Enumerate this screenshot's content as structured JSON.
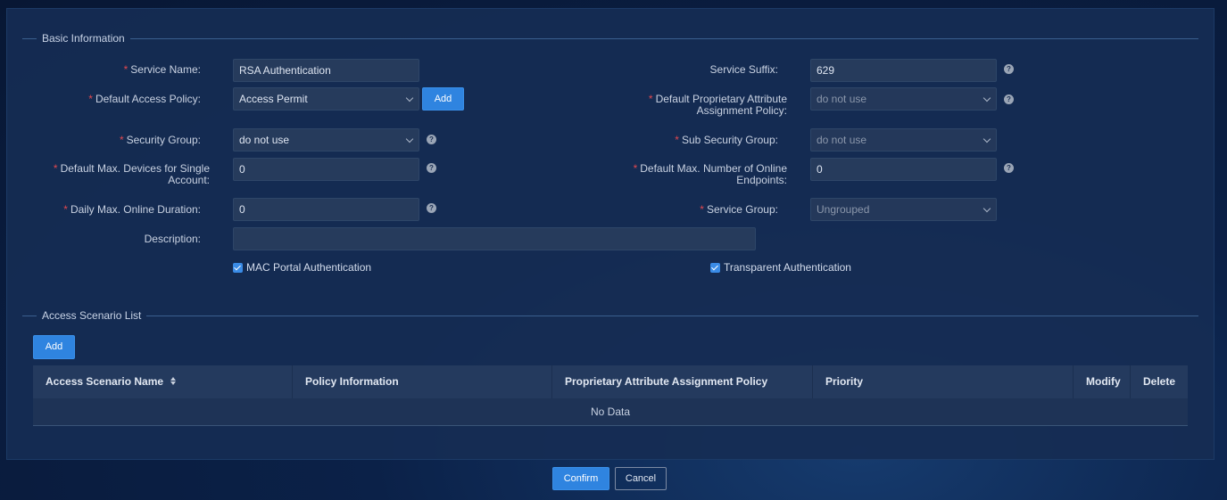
{
  "basic_section": {
    "title": "Basic Information"
  },
  "fields": {
    "service_name": {
      "label": "Service Name:",
      "value": "RSA Authentication",
      "required": true
    },
    "service_suffix": {
      "label": "Service Suffix:",
      "value": "629",
      "required": false
    },
    "default_access_policy": {
      "label": "Default Access Policy:",
      "value": "Access Permit",
      "required": true,
      "add_label": "Add"
    },
    "default_proprietary_policy": {
      "label_line1": "Default Proprietary Attribute",
      "label_line2": "Assignment Policy:",
      "value": "do not use",
      "required": true
    },
    "security_group": {
      "label": "Security Group:",
      "value": "do not use",
      "required": true
    },
    "sub_security_group": {
      "label": "Sub Security Group:",
      "value": "do not use",
      "required": true
    },
    "max_devices": {
      "label_line1": "Default Max. Devices for Single",
      "label_line2": "Account:",
      "value": "0",
      "required": true
    },
    "max_online_endpoints": {
      "label_line1": "Default Max. Number of Online",
      "label_line2": "Endpoints:",
      "value": "0",
      "required": true
    },
    "daily_max_duration": {
      "label": "Daily Max. Online Duration:",
      "value": "0",
      "required": true
    },
    "service_group": {
      "label": "Service Group:",
      "value": "Ungrouped",
      "required": true
    },
    "description": {
      "label": "Description:",
      "value": ""
    }
  },
  "checkboxes": {
    "mac_portal": {
      "label": "MAC Portal Authentication",
      "checked": true
    },
    "transparent": {
      "label": "Transparent Authentication",
      "checked": true
    }
  },
  "scenario_section": {
    "title": "Access Scenario List",
    "add_label": "Add",
    "columns": [
      "Access Scenario Name",
      "Policy Information",
      "Proprietary Attribute Assignment Policy",
      "Priority",
      "Modify",
      "Delete"
    ],
    "empty_text": "No Data"
  },
  "footer": {
    "confirm_label": "Confirm",
    "cancel_label": "Cancel"
  },
  "icons": {
    "help": "?"
  },
  "colors": {
    "primary": "#2f84e0",
    "required": "#e0484f",
    "panel": "#162c54"
  }
}
